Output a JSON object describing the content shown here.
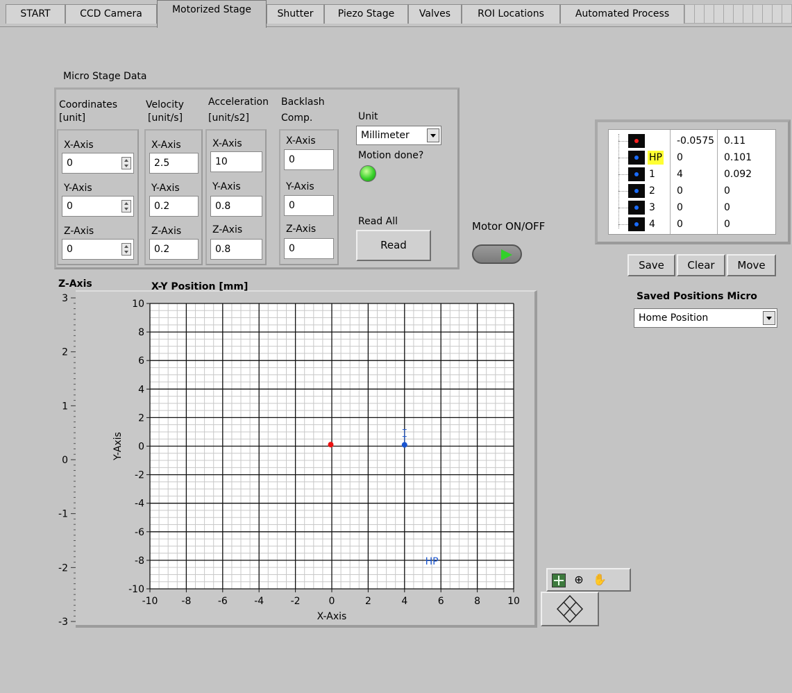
{
  "tabs": [
    "START",
    "CCD Camera",
    "Motorized Stage",
    "Shutter",
    "Piezo Stage",
    "Valves",
    "ROI Locations",
    "Automated Process"
  ],
  "active_tab": "Motorized Stage",
  "micro_stage": {
    "title": "Micro Stage Data",
    "coordinates": {
      "header": [
        "Coordinates",
        "[unit]"
      ],
      "x_label": "X-Axis",
      "x": "0",
      "y_label": "Y-Axis",
      "y": "0",
      "z_label": "Z-Axis",
      "z": "0"
    },
    "velocity": {
      "header": [
        "Velocity",
        "[unit/s]"
      ],
      "x_label": "X-Axis",
      "x": "2.5",
      "y_label": "Y-Axis",
      "y": "0.2",
      "z_label": "Z-Axis",
      "z": "0.2"
    },
    "acceleration": {
      "header": [
        "Acceleration",
        "[unit/s2]"
      ],
      "x_label": "X-Axis",
      "x": "10",
      "y_label": "Y-Axis",
      "y": "0.8",
      "z_label": "Z-Axis",
      "z": "0.8"
    },
    "backlash": {
      "header": [
        "Backlash",
        "Comp."
      ],
      "x_label": "X-Axis",
      "x": "0",
      "y_label": "Y-Axis",
      "y": "0",
      "z_label": "Z-Axis",
      "z": "0"
    },
    "unit_label": "Unit",
    "unit_value": "Millimeter",
    "motion_done_label": "Motion done?",
    "read_all_label": "Read All",
    "read_button": "Read"
  },
  "motor_label": "Motor ON/OFF",
  "positions_table": {
    "rows": [
      {
        "marker_color": "#ff2020",
        "name": "",
        "x": "-0.0575",
        "y": "0.11"
      },
      {
        "marker_color": "#1a6cff",
        "name": "HP",
        "x": "0",
        "y": "0.101"
      },
      {
        "marker_color": "#1a6cff",
        "name": "1",
        "x": "4",
        "y": "0.092"
      },
      {
        "marker_color": "#1a6cff",
        "name": "2",
        "x": "0",
        "y": "0"
      },
      {
        "marker_color": "#1a6cff",
        "name": "3",
        "x": "0",
        "y": "0"
      },
      {
        "marker_color": "#1a6cff",
        "name": "4",
        "x": "0",
        "y": "0"
      }
    ]
  },
  "buttons": {
    "save": "Save",
    "clear": "Clear",
    "move": "Move"
  },
  "saved_positions": {
    "label": "Saved Positions Micro",
    "value": "Home Position"
  },
  "z_axis": {
    "title": "Z-Axis",
    "ticks": [
      "3",
      "2",
      "1",
      "0",
      "-1",
      "-2",
      "-3"
    ],
    "value": 0,
    "range": [
      -3,
      3
    ]
  },
  "chart_data": {
    "type": "scatter",
    "title": "X-Y Position [mm]",
    "xlabel": "X-Axis",
    "ylabel": "Y-Axis",
    "xlim": [
      -10,
      10
    ],
    "ylim": [
      -10,
      10
    ],
    "xticks": [
      "-10",
      "-8",
      "-6",
      "-4",
      "-2",
      "0",
      "2",
      "4",
      "6",
      "8",
      "10"
    ],
    "yticks": [
      "10",
      "8",
      "6",
      "4",
      "2",
      "0",
      "-2",
      "-4",
      "-6",
      "-8",
      "-10"
    ],
    "grid": true,
    "series": [
      {
        "color": "#ee1111",
        "points": [
          [
            -0.0575,
            0.11
          ]
        ]
      },
      {
        "color": "#1a55d0",
        "points": [
          [
            4,
            0.092
          ]
        ]
      }
    ],
    "annotation": {
      "text": "HP",
      "x": 5.5,
      "y": -8,
      "color": "#1a55d0"
    }
  }
}
